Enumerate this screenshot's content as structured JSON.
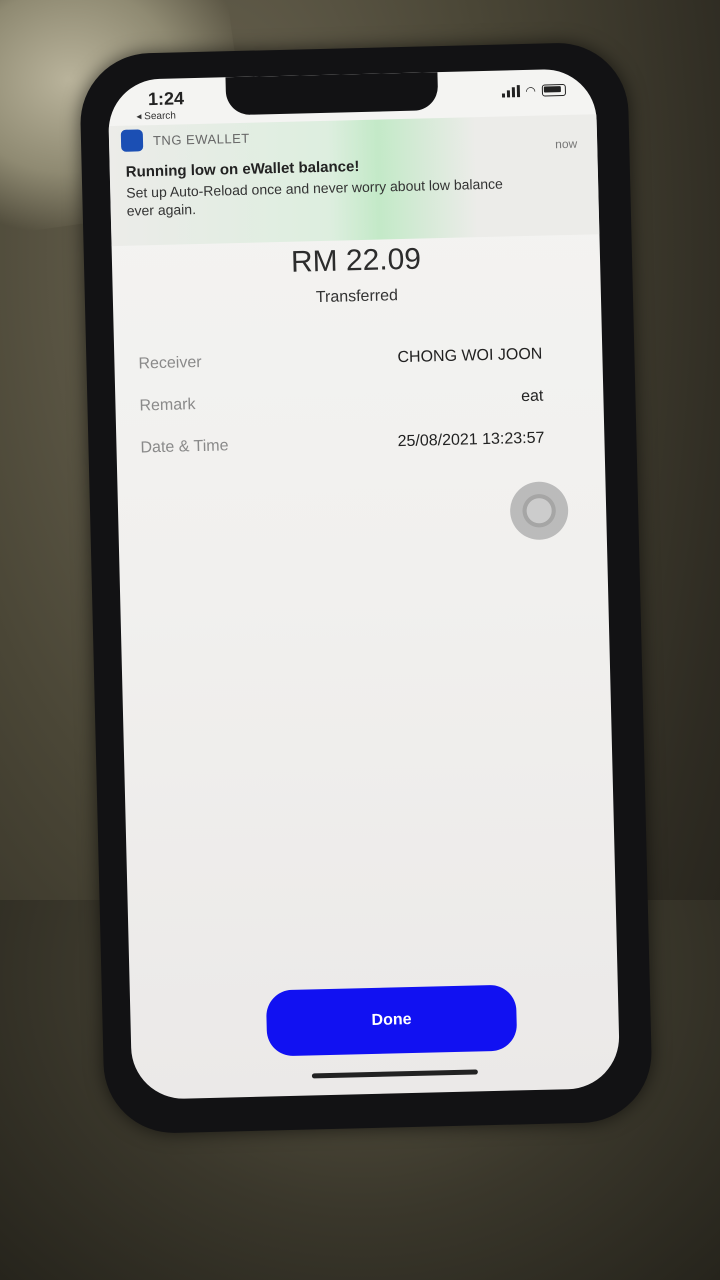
{
  "status_bar": {
    "time": "1:24",
    "back_label": "◂ Search"
  },
  "notification": {
    "app_name": "TNG EWALLET",
    "time": "now",
    "title": "Running low on eWallet balance!",
    "body": "Set up Auto-Reload once and never worry about low balance ever again."
  },
  "transaction": {
    "amount": "RM 22.09",
    "status": "Transferred",
    "details": [
      {
        "label": "Receiver",
        "value": "CHONG WOI JOON"
      },
      {
        "label": "Remark",
        "value": "eat"
      },
      {
        "label": "Date & Time",
        "value": "25/08/2021 13:23:57"
      }
    ]
  },
  "actions": {
    "done_label": "Done"
  },
  "colors": {
    "primary_button": "#1111f2"
  }
}
